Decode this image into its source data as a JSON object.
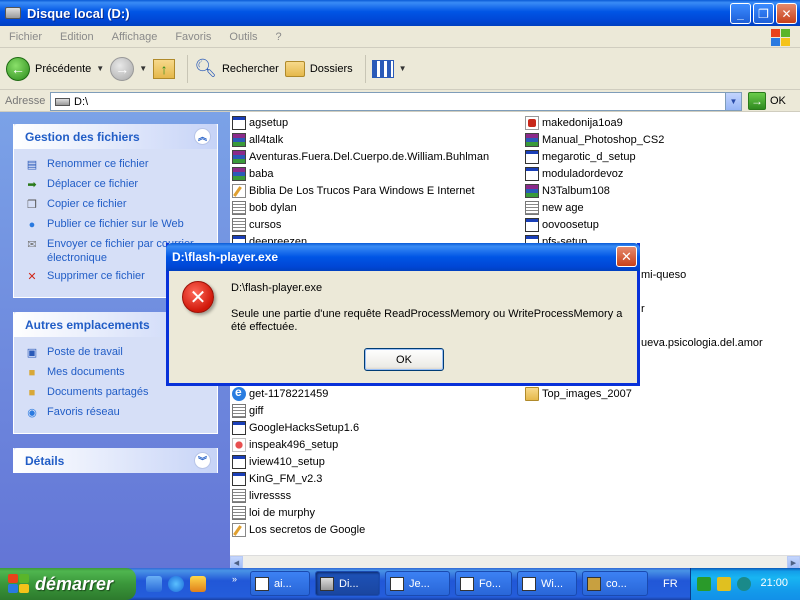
{
  "window": {
    "title": "Disque local (D:)"
  },
  "menu": [
    "Fichier",
    "Edition",
    "Affichage",
    "Favoris",
    "Outils",
    "?"
  ],
  "toolbar": {
    "back_label": "Précédente",
    "search_label": "Rechercher",
    "folders_label": "Dossiers"
  },
  "address": {
    "label": "Adresse",
    "value": "D:\\",
    "go_label": "OK"
  },
  "tasks": {
    "files_panel": {
      "title": "Gestion des fichiers",
      "items": [
        "Renommer ce fichier",
        "Déplacer ce fichier",
        "Copier ce fichier",
        "Publier ce fichier sur le Web",
        "Envoyer ce fichier par courrier électronique",
        "Supprimer ce fichier"
      ]
    },
    "places_panel": {
      "title": "Autres emplacements",
      "items": [
        "Poste de travail",
        "Mes documents",
        "Documents partagés",
        "Favoris réseau"
      ]
    },
    "details_panel": {
      "title": "Détails"
    }
  },
  "files": {
    "col1": [
      {
        "name": "agsetup",
        "icon": "exe-icon"
      },
      {
        "name": "all4talk",
        "icon": "rar-icon"
      },
      {
        "name": "Aventuras.Fuera.Del.Cuerpo.de.William.Buhlman",
        "icon": "rar-icon"
      },
      {
        "name": "baba",
        "icon": "rar-icon"
      },
      {
        "name": "Biblia De Los Trucos Para Windows E Internet",
        "icon": "write-icon"
      },
      {
        "name": "bob dylan",
        "icon": "text-icon"
      },
      {
        "name": "cursos",
        "icon": "text-icon"
      },
      {
        "name": "deepreezen",
        "icon": "exe-icon"
      }
    ],
    "col1_lower": [
      {
        "name": "get-1178221459",
        "icon": "ie-icon"
      },
      {
        "name": "giff",
        "icon": "text-icon"
      },
      {
        "name": "GoogleHacksSetup1.6",
        "icon": "exe-icon"
      },
      {
        "name": "inspeak496_setup",
        "icon": "app-icon"
      },
      {
        "name": "iview410_setup",
        "icon": "exe-icon"
      },
      {
        "name": "KinG_FM_v2.3",
        "icon": "exe-icon"
      },
      {
        "name": "livressss",
        "icon": "text-icon"
      },
      {
        "name": "loi de murphy",
        "icon": "text-icon"
      },
      {
        "name": "Los secretos de Google",
        "icon": "write-icon"
      }
    ],
    "col2": [
      {
        "name": "makedonija1oa9",
        "icon": "pdf-icon"
      },
      {
        "name": "Manual_Photoshop_CS2",
        "icon": "rar-icon"
      },
      {
        "name": "megarotic_d_setup",
        "icon": "exe-icon"
      },
      {
        "name": "moduladordevoz",
        "icon": "exe-icon"
      },
      {
        "name": "N3Talbum108",
        "icon": "rar-icon"
      },
      {
        "name": "new age",
        "icon": "text-icon"
      },
      {
        "name": "oovoosetup",
        "icon": "exe-icon"
      },
      {
        "name": "pfs-setup",
        "icon": "exe-icon"
      }
    ],
    "col2_partial": [
      {
        "name": "mi-queso"
      },
      {
        "name": "r"
      },
      {
        "name": "ueva.psicologia.del.amor"
      }
    ],
    "col2_lower": [
      {
        "name": "Top_images_2007",
        "icon": "folder-icon"
      }
    ]
  },
  "dialog": {
    "title": "D:\\flash-player.exe",
    "path": "D:\\flash-player.exe",
    "message": "Seule une partie d'une requête ReadProcessMemory ou WriteProcessMemory a été effectuée.",
    "ok_label": "OK"
  },
  "taskbar": {
    "start_label": "démarrer",
    "tasks": [
      "ai...",
      "Di...",
      "Je...",
      "Fo...",
      "Wi...",
      "co..."
    ],
    "language": "FR",
    "clock": "21:00"
  },
  "colors": {
    "xp_blue": "#0055E5",
    "link_blue": "#215DC6",
    "start_green": "#3C9A3C"
  }
}
